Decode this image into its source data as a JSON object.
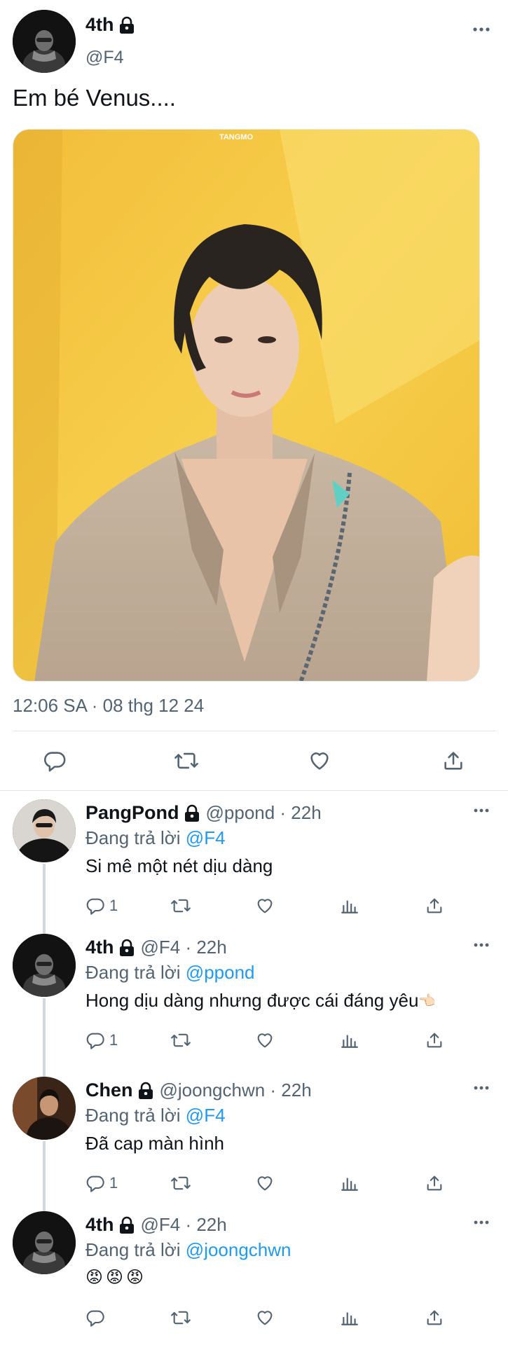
{
  "main_tweet": {
    "author_name": "4th",
    "author_handle": "@F4",
    "text": "Em bé Venus....",
    "photo_watermark": "TANGMO",
    "timestamp": "12:06 SA · 08 thg 12 24"
  },
  "replies": [
    {
      "name": "PangPond",
      "meta": "@ppond · 22h",
      "replying_prefix": "Đang trả lời",
      "replying_to": "@F4",
      "text": "Si mê một nét dịu dàng",
      "reply_count": "1"
    },
    {
      "name": "4th",
      "meta": "@F4 · 22h",
      "replying_prefix": "Đang trả lời",
      "replying_to": "@ppond",
      "text": "Hong dịu dàng nhưng được cái đáng yêu",
      "trailing_emoji": "👈🏻",
      "reply_count": "1"
    },
    {
      "name": "Chen",
      "meta": "@joongchwn · 22h",
      "replying_prefix": "Đang trả lời",
      "replying_to": "@F4",
      "text": "Đã cap màn hình",
      "reply_count": "1"
    },
    {
      "name": "4th",
      "meta": "@F4 · 22h",
      "replying_prefix": "Đang trả lời",
      "replying_to": "@joongchwn",
      "text": "😡😡😡",
      "reply_count": ""
    }
  ],
  "colors": {
    "text_primary": "#0f1419",
    "text_secondary": "#536471",
    "link": "#1d9bf0",
    "thread_line": "#cfd9de"
  },
  "icons": [
    "lock-icon",
    "more-icon",
    "reply-icon",
    "retweet-icon",
    "like-icon",
    "views-icon",
    "share-icon"
  ]
}
